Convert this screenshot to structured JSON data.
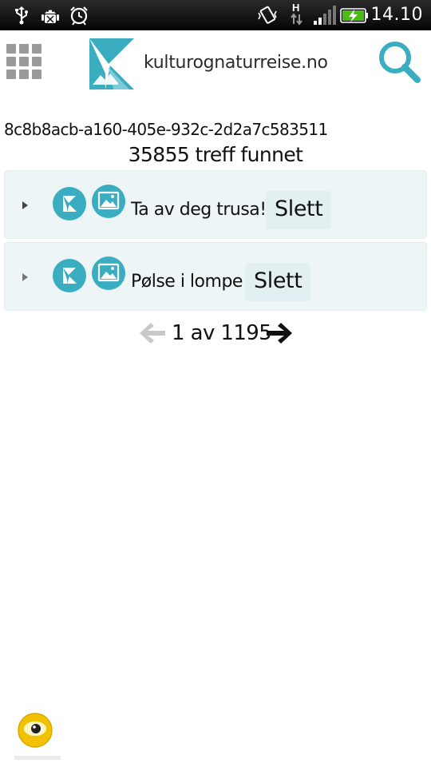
{
  "status_bar": {
    "time": "14.10",
    "icons": [
      "usb-icon",
      "android-debug-icon",
      "alarm-icon",
      "vibrate-icon",
      "hspa-data-icon",
      "signal-icon",
      "battery-charging-icon"
    ]
  },
  "header": {
    "logo_text": "kulturognaturreise.no",
    "menu_icon": "grid-menu-icon",
    "search_icon": "search-icon"
  },
  "search": {
    "id": "8c8b8acb-a160-405e-932c-2d2a7c583511",
    "hits": "35855 treff funnet"
  },
  "results": [
    {
      "title": "Ta av deg trusa!",
      "delete_label": "Slett",
      "provider_icon": "kulturognaturreise-provider-icon",
      "type_icon": "image-type-icon"
    },
    {
      "title": "Pølse i lompe",
      "delete_label": "Slett",
      "provider_icon": "kulturognaturreise-provider-icon",
      "type_icon": "image-type-icon"
    }
  ],
  "pagination": {
    "label": "1 av 1195",
    "prev_icon": "arrow-left-icon",
    "next_icon": "arrow-right-icon"
  },
  "colors": {
    "accent": "#3aaec0",
    "row_background": "#edf5f6",
    "button_background": "#e3f0f2",
    "menu_grey": "#9a9a9a",
    "disabled_arrow": "#c8c8c8"
  }
}
